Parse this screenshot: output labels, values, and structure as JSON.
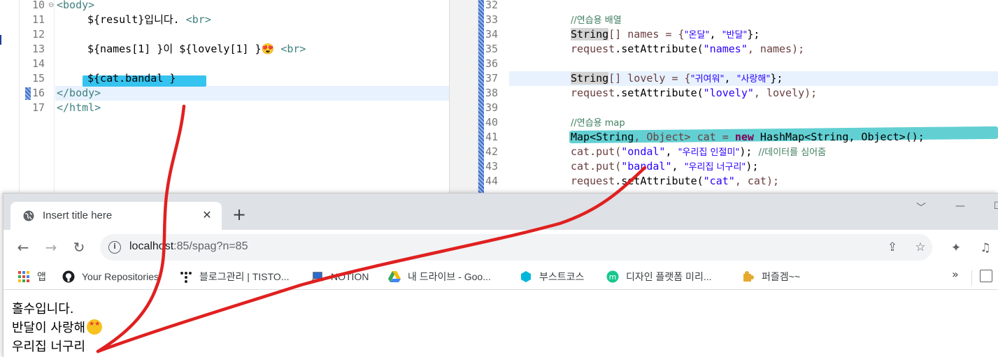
{
  "left_editor": {
    "lines": [
      {
        "num": "10",
        "html_parts": {
          "a": "<body>"
        }
      },
      {
        "num": "11",
        "text": "${result}입니다. <br>"
      },
      {
        "num": "12",
        "text": ""
      },
      {
        "num": "13",
        "text": "${names[1] }이 ${lovely[1] }😍 <br>"
      },
      {
        "num": "14",
        "text": ""
      },
      {
        "num": "15",
        "text": "${cat.bandal }"
      },
      {
        "num": "16",
        "text": "</body>"
      },
      {
        "num": "17",
        "text": "</html>"
      }
    ],
    "fold_marker": "⊖"
  },
  "right_editor": {
    "line_numbers": [
      "32",
      "33",
      "34",
      "35",
      "36",
      "37",
      "38",
      "39",
      "40",
      "41",
      "42",
      "43",
      "44"
    ],
    "comment_array": "//연습용 배열",
    "comment_map": "//연습용 map",
    "type_string": "String",
    "names_decl": "[] names = {",
    "names_v1": "\"온달\"",
    "names_sep": ", ",
    "names_v2": "\"반달\"",
    "decl_end": "};",
    "req": "request",
    "set_attr": ".setAttribute(",
    "attr_names": "\"names\"",
    "names_arg": ", names);",
    "lovely_decl": "[] lovely = {",
    "lovely_v1": "\"귀여워\"",
    "lovely_v2": "\"사랑해\"",
    "attr_lovely": "\"lovely\"",
    "lovely_arg": ", lovely);",
    "map_decl_a": "Map<",
    "map_decl_b": ", Object> cat = ",
    "kw_new": "new",
    "map_decl_c": " HashMap<",
    "map_decl_d": ", Object>();",
    "put1_a": "cat.put(",
    "put1_key": "\"ondal\"",
    "put1_sep": ", ",
    "put1_val": "\"우리집 인절미\"",
    "put1_end": "); ",
    "put1_comment": "//데이터를 심어줌",
    "put2_key": "\"bandal\"",
    "put2_val": "\"우리집 너구리\"",
    "put2_end": ");",
    "attr_cat": "\"cat\"",
    "cat_arg": ", cat);"
  },
  "browser": {
    "tab_title": "Insert title here",
    "tab_close": "✕",
    "new_tab": "+",
    "window_controls": [
      "﹀",
      "—",
      "☐"
    ],
    "nav": {
      "back": "←",
      "forward": "→",
      "reload": "↻"
    },
    "url_host": "localhost",
    "url_path": ":85/spag?n=85",
    "info_icon": "i",
    "omni_icons": {
      "share": "⇪",
      "star": "☆"
    },
    "extensions": {
      "puzzle": "✦",
      "media": "♫"
    },
    "bookmarks": [
      {
        "label": "앱",
        "icon": "apps-grid-icon"
      },
      {
        "label": "Your Repositories",
        "icon": "github-icon"
      },
      {
        "label": "블로그관리 | TISTO...",
        "icon": "tistory-icon"
      },
      {
        "label": "NOTION",
        "icon": "laptop-icon"
      },
      {
        "label": "내 드라이브 - Goo...",
        "icon": "google-drive-icon"
      },
      {
        "label": "부스트코스",
        "icon": "boostcourse-icon"
      },
      {
        "label": "디자인 플랫폼 미리...",
        "icon": "miricanvas-icon"
      },
      {
        "label": "퍼즐겜~~",
        "icon": "puzzle-piece-icon"
      }
    ],
    "bookmarks_more": "»",
    "page_lines": [
      "홀수입니다.",
      "반달이 사랑해",
      "우리집 너구리"
    ]
  },
  "colors": {
    "annotation_red": "#e02020",
    "highlight_cyan": "#35c3ef",
    "jsp_tag": "#3f7f7f",
    "java_string": "#2a00ff",
    "java_comment": "#3f7f5f",
    "java_keyword": "#7f0055"
  }
}
